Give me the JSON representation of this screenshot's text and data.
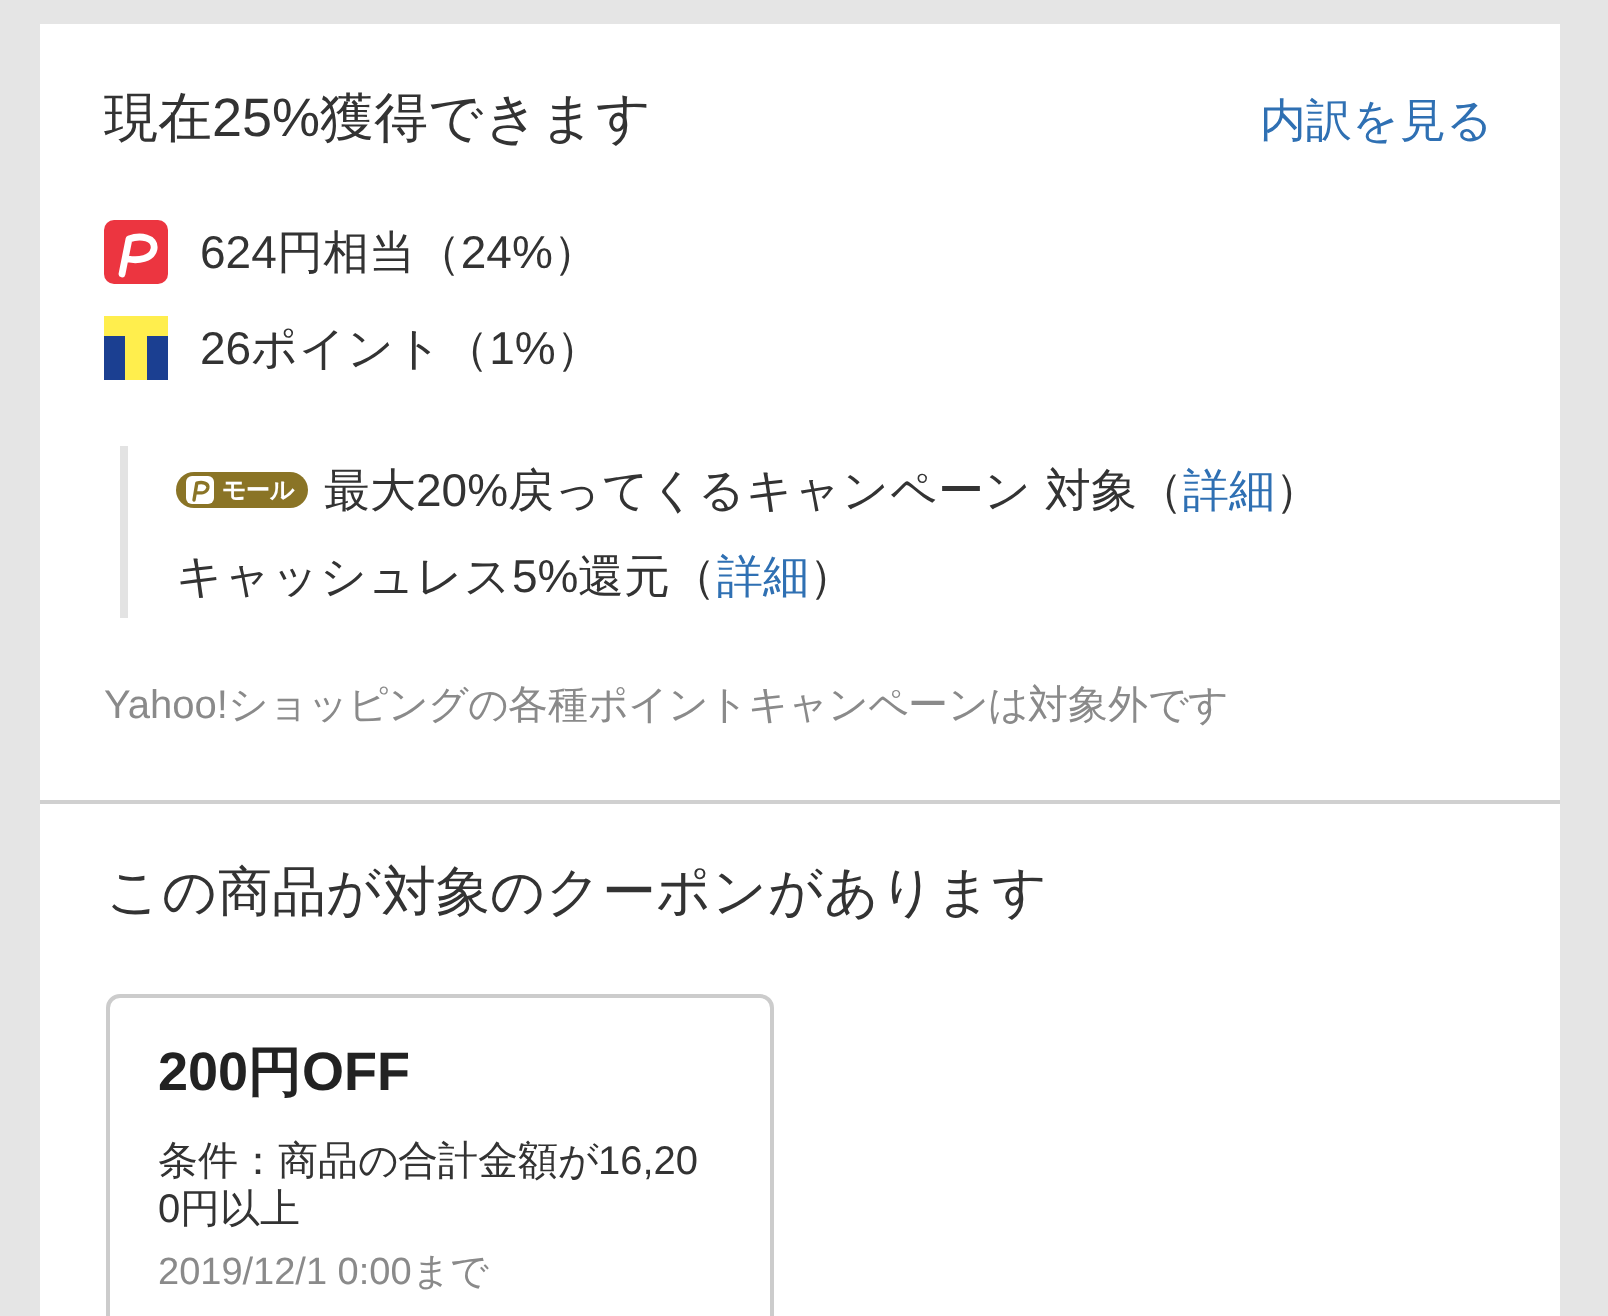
{
  "points_section": {
    "title": "現在25%獲得できます",
    "breakdown_link": "内訳を見る",
    "rewards": [
      {
        "kind": "paypay",
        "text": "624円相当（24%）"
      },
      {
        "kind": "tpoint",
        "text": "26ポイント（1%）"
      }
    ],
    "campaigns": [
      {
        "kind": "mall",
        "badge": "モール",
        "text": "最大20%戻ってくるキャンペーン 対象（",
        "link": "詳細",
        "text_after": "）"
      },
      {
        "kind": "plain",
        "text": "キャッシュレス5%還元（",
        "link": "詳細",
        "text_after": "）"
      }
    ],
    "note": "Yahoo!ショッピングの各種ポイントキャンペーンは対象外です"
  },
  "coupon_section": {
    "title": "この商品が対象のクーポンがあります",
    "coupons": [
      {
        "amount": "200円OFF",
        "condition": "条件：商品の合計金額が16,200円以上",
        "expiry": "2019/12/1 0:00まで"
      }
    ]
  }
}
